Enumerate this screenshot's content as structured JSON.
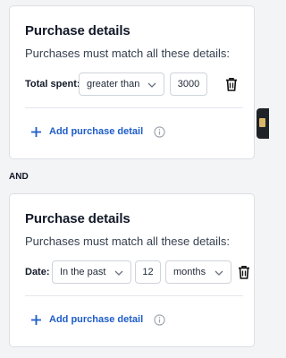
{
  "cards": [
    {
      "title": "Purchase details",
      "subtitle": "Purchases must match all these details:",
      "condition": {
        "label": "Total spent:",
        "operator": "greater than",
        "value": "3000"
      },
      "add_label": "Add purchase detail"
    },
    {
      "title": "Purchase details",
      "subtitle": "Purchases must match all these details:",
      "condition": {
        "label": "Date:",
        "operator": "In the past",
        "value": "12",
        "unit": "months"
      },
      "add_label": "Add purchase detail"
    }
  ],
  "connector": "AND",
  "colors": {
    "accent": "#1d5cc9",
    "border": "#dcdfe4",
    "background": "#f3f4f6"
  },
  "icons": [
    "trash-icon",
    "plus-icon",
    "info-icon",
    "chevron-down-icon"
  ]
}
